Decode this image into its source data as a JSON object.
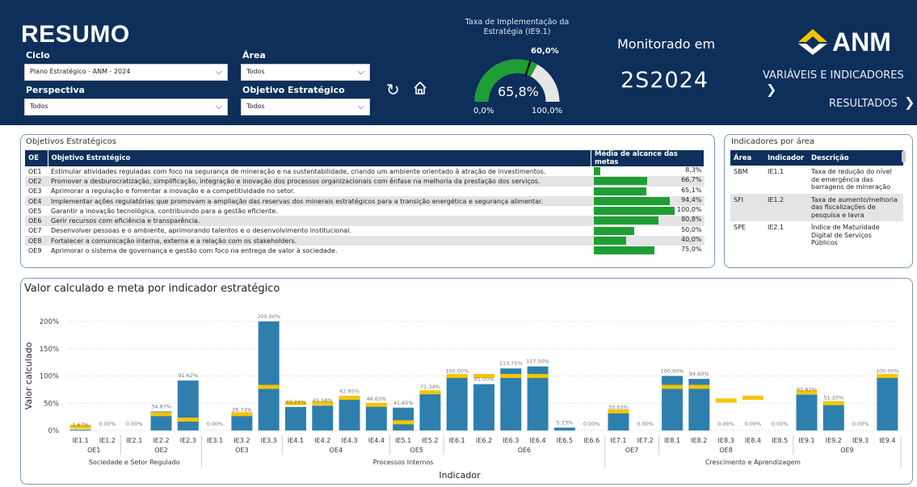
{
  "header": {
    "title": "RESUMO",
    "filters": {
      "ciclo": {
        "label": "Ciclo",
        "value": "Plano Estratégico - ANM - 2024"
      },
      "area": {
        "label": "Área",
        "value": "Todos"
      },
      "perspectiva": {
        "label": "Perspectiva",
        "value": "Todos"
      },
      "objetivo": {
        "label": "Objetivo Estratégico",
        "value": "Todos"
      }
    },
    "gauge": {
      "title": "Taxa de Implementação da Estratégia (IE9.1)",
      "value": "65,8%",
      "target": "60,0%",
      "min": "0,0%",
      "max": "100,0%",
      "value_frac": 0.658,
      "target_frac": 0.6,
      "fill_color": "#1f9e34",
      "track_color": "#e6e6e6"
    },
    "monitorado": {
      "label": "Monitorado em",
      "value": "2S2024"
    },
    "logo": "ANM",
    "nav": {
      "variaveis": "VARIÁVEIS E INDICADORES",
      "resultados": "RESULTADOS"
    },
    "icons": {
      "refresh": "refresh-icon",
      "home": "home-icon"
    }
  },
  "objetivos": {
    "title": "Objetivos Estratégicos",
    "headers": [
      "OE",
      "Objetivo Estratégico",
      "Média de alcance das metas"
    ],
    "rows": [
      {
        "oe": "OE1",
        "desc": "Estimular atividades reguladas com foco na segurança de mineração e na sustentabilidade, criando um ambiente orientado à atração de investimentos.",
        "value": "8,3%",
        "frac": 0.083
      },
      {
        "oe": "OE2",
        "desc": "Promover a desburocratização, simplificação, integração e inovação dos processos organizacionais com ênfase na melhoria da prestação dos serviços.",
        "value": "66,7%",
        "frac": 0.667
      },
      {
        "oe": "OE3",
        "desc": "Aprimorar a regulação e fomentar a inovação e a competitividade no setor.",
        "value": "65,1%",
        "frac": 0.651
      },
      {
        "oe": "OE4",
        "desc": "Implementar ações regulatórias que promovam a ampliação das reservas dos minerais estratégicos para a transição energética e segurança alimentar.",
        "value": "94,4%",
        "frac": 0.944
      },
      {
        "oe": "OE5",
        "desc": "Garantir a inovação tecnológica, contribuindo para a gestão eficiente.",
        "value": "100,0%",
        "frac": 1.0
      },
      {
        "oe": "OE6",
        "desc": "Gerir recursos com eficiência e transparência.",
        "value": "80,8%",
        "frac": 0.808
      },
      {
        "oe": "OE7",
        "desc": "Desenvolver pessoas e o ambiente, aprimorando talentos e o desenvolvimento institucional.",
        "value": "50,0%",
        "frac": 0.5
      },
      {
        "oe": "OE8",
        "desc": "Fortalecer a comunicação interna, externa e a relação com os stakeholders.",
        "value": "40,0%",
        "frac": 0.4
      },
      {
        "oe": "OE9",
        "desc": "Aprimorar o sistema de governança e gestão com foco na entrega de valor à sociedade.",
        "value": "75,0%",
        "frac": 0.75
      }
    ]
  },
  "indicadores": {
    "title": "Indicadores por área",
    "headers": [
      "Área",
      "Indicador",
      "Descrição"
    ],
    "rows": [
      {
        "area": "SBM",
        "ind": "IE1.1",
        "desc": "Taxa de redução do nível de emergência das barragens de mineração"
      },
      {
        "area": "SFI",
        "ind": "IE1.2",
        "desc": "Taxa de aumento/melhoria das fiscalizações de pesquisa e lavra"
      },
      {
        "area": "SPE",
        "ind": "IE2.1",
        "desc": "Índice de Maturidade Digital de Serviços Públicos"
      }
    ]
  },
  "chart_data": {
    "type": "bar",
    "title": "Valor calculado e meta por indicador estratégico",
    "xlabel": "Indicador",
    "ylabel": "Valor calculado",
    "ylim": [
      0,
      200
    ],
    "yticks": [
      "0%",
      "50%",
      "100%",
      "150%",
      "200%"
    ],
    "bar_color": "#2e7fad",
    "target_color": "#f5c400",
    "categories": [
      "IE1.1",
      "IE1.2",
      "IE2.1",
      "IE2.2",
      "IE2.3",
      "IE3.1",
      "IE3.2",
      "IE3.3",
      "IE4.1",
      "IE4.2",
      "IE4.3",
      "IE4.4",
      "IE5.1",
      "IE5.2",
      "IE6.1",
      "IE6.2",
      "IE6.3",
      "IE6.4",
      "IE6.5",
      "IE6.6",
      "IE7.1",
      "IE7.2",
      "IE8.1",
      "IE8.2",
      "IE8.3",
      "IE8.4",
      "IE8.5",
      "IE9.1",
      "IE9.2",
      "IE9.3",
      "IE9.4"
    ],
    "values": [
      1.67,
      0,
      0,
      34.87,
      91.62,
      0,
      28.74,
      200,
      43.24,
      45.58,
      62.95,
      48.63,
      41.85,
      71.34,
      100,
      85,
      113.75,
      117.5,
      5.23,
      0,
      33.03,
      0,
      100,
      94.6,
      0,
      0,
      0,
      65.82,
      51.2,
      0,
      100
    ],
    "value_labels": [
      "1.67%",
      "0.00%",
      "0.00%",
      "34.87%",
      "91.62%",
      "0.00%",
      "28.74%",
      "200.00%",
      "43.24%",
      "45.58%",
      "62.95%",
      "48.63%",
      "41.85%",
      "71.34%",
      "100.00%",
      "85.00%",
      "113.75%",
      "117.50%",
      "5.23%",
      "0.00%",
      "33.03%",
      "0.00%",
      "100.00%",
      "94.60%",
      "0.00%",
      "0.00%",
      "0.00%",
      "65.82%",
      "51.20%",
      "0.00%",
      "100.00%"
    ],
    "targets": [
      7,
      null,
      null,
      30,
      20,
      null,
      30,
      80,
      50,
      50,
      60,
      47,
      15,
      70,
      100,
      100,
      100,
      100,
      null,
      null,
      35,
      null,
      80,
      80,
      55,
      60,
      null,
      70,
      50,
      null,
      100
    ],
    "groups": [
      {
        "label": "OE1",
        "start": 0,
        "end": 1
      },
      {
        "label": "OE2",
        "start": 2,
        "end": 4
      },
      {
        "label": "OE3",
        "start": 5,
        "end": 7
      },
      {
        "label": "OE4",
        "start": 8,
        "end": 11
      },
      {
        "label": "OE5",
        "start": 12,
        "end": 13
      },
      {
        "label": "OE6",
        "start": 14,
        "end": 19
      },
      {
        "label": "OE7",
        "start": 20,
        "end": 21
      },
      {
        "label": "OE8",
        "start": 22,
        "end": 26
      },
      {
        "label": "OE9",
        "start": 27,
        "end": 30
      }
    ],
    "perspectives": [
      {
        "label": "Sociedade e Setor Regulado",
        "start": 0,
        "end": 4
      },
      {
        "label": "Processos Internos",
        "start": 5,
        "end": 19
      },
      {
        "label": "Crescimento e Aprendizagem",
        "start": 20,
        "end": 30
      }
    ],
    "grid": true
  }
}
